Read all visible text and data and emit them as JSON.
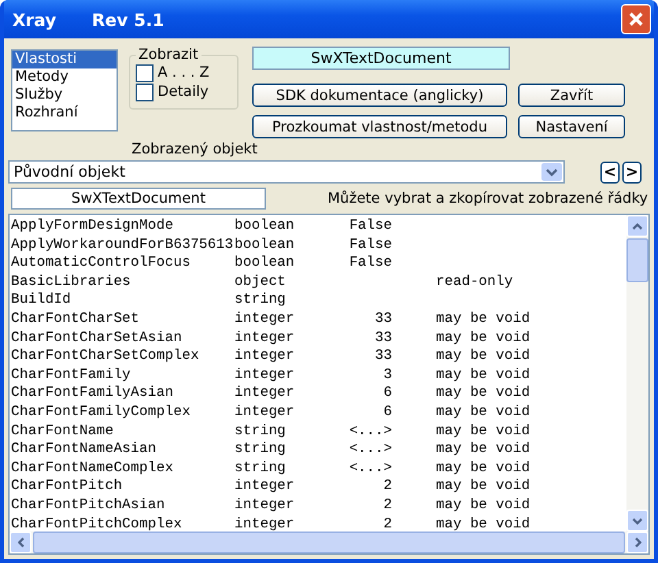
{
  "window": {
    "title": "Xray",
    "version": "Rev 5.1"
  },
  "views": [
    {
      "label": "Vlastosti",
      "selected": true
    },
    {
      "label": "Metody",
      "selected": false
    },
    {
      "label": "Služby",
      "selected": false
    },
    {
      "label": "Rozhraní",
      "selected": false
    }
  ],
  "display_group": {
    "title": "Zobrazit",
    "options": [
      {
        "label": "A . . . Z",
        "checked": false
      },
      {
        "label": "Detaily",
        "checked": false
      }
    ]
  },
  "object_name": "SwXTextDocument",
  "buttons": [
    "SDK dokumentace (anglicky)",
    "Zavřít",
    "Prozkoumat vlastnost/metodu",
    "Nastavení"
  ],
  "shown_object_label": "Zobrazený objekt",
  "object_select": {
    "value": "Původní objekt"
  },
  "nav": [
    "<",
    ">"
  ],
  "type_field": "SwXTextDocument",
  "hint": "Můžete vybrat a zkopírovat zobrazené řádky",
  "rows": [
    {
      "name": "ApplyFormDesignMode",
      "type": "boolean",
      "value": "False",
      "note": ""
    },
    {
      "name": "ApplyWorkaroundForB6375613",
      "type": "boolean",
      "value": "False",
      "note": ""
    },
    {
      "name": "AutomaticControlFocus",
      "type": "boolean",
      "value": "False",
      "note": ""
    },
    {
      "name": "BasicLibraries",
      "type": "object",
      "value": "",
      "note": "read-only"
    },
    {
      "name": "BuildId",
      "type": "string",
      "value": "",
      "note": ""
    },
    {
      "name": "CharFontCharSet",
      "type": "integer",
      "value": "33",
      "note": "may be void"
    },
    {
      "name": "CharFontCharSetAsian",
      "type": "integer",
      "value": "33",
      "note": "may be void"
    },
    {
      "name": "CharFontCharSetComplex",
      "type": "integer",
      "value": "33",
      "note": "may be void"
    },
    {
      "name": "CharFontFamily",
      "type": "integer",
      "value": "3",
      "note": "may be void"
    },
    {
      "name": "CharFontFamilyAsian",
      "type": "integer",
      "value": "6",
      "note": "may be void"
    },
    {
      "name": "CharFontFamilyComplex",
      "type": "integer",
      "value": "6",
      "note": "may be void"
    },
    {
      "name": "CharFontName",
      "type": "string",
      "value": "<...>",
      "note": "may be void"
    },
    {
      "name": "CharFontNameAsian",
      "type": "string",
      "value": "<...>",
      "note": "may be void"
    },
    {
      "name": "CharFontNameComplex",
      "type": "string",
      "value": "<...>",
      "note": "may be void"
    },
    {
      "name": "CharFontPitch",
      "type": "integer",
      "value": "2",
      "note": "may be void"
    },
    {
      "name": "CharFontPitchAsian",
      "type": "integer",
      "value": "2",
      "note": "may be void"
    },
    {
      "name": "CharFontPitchComplex",
      "type": "integer",
      "value": "2",
      "note": "may be void"
    }
  ]
}
